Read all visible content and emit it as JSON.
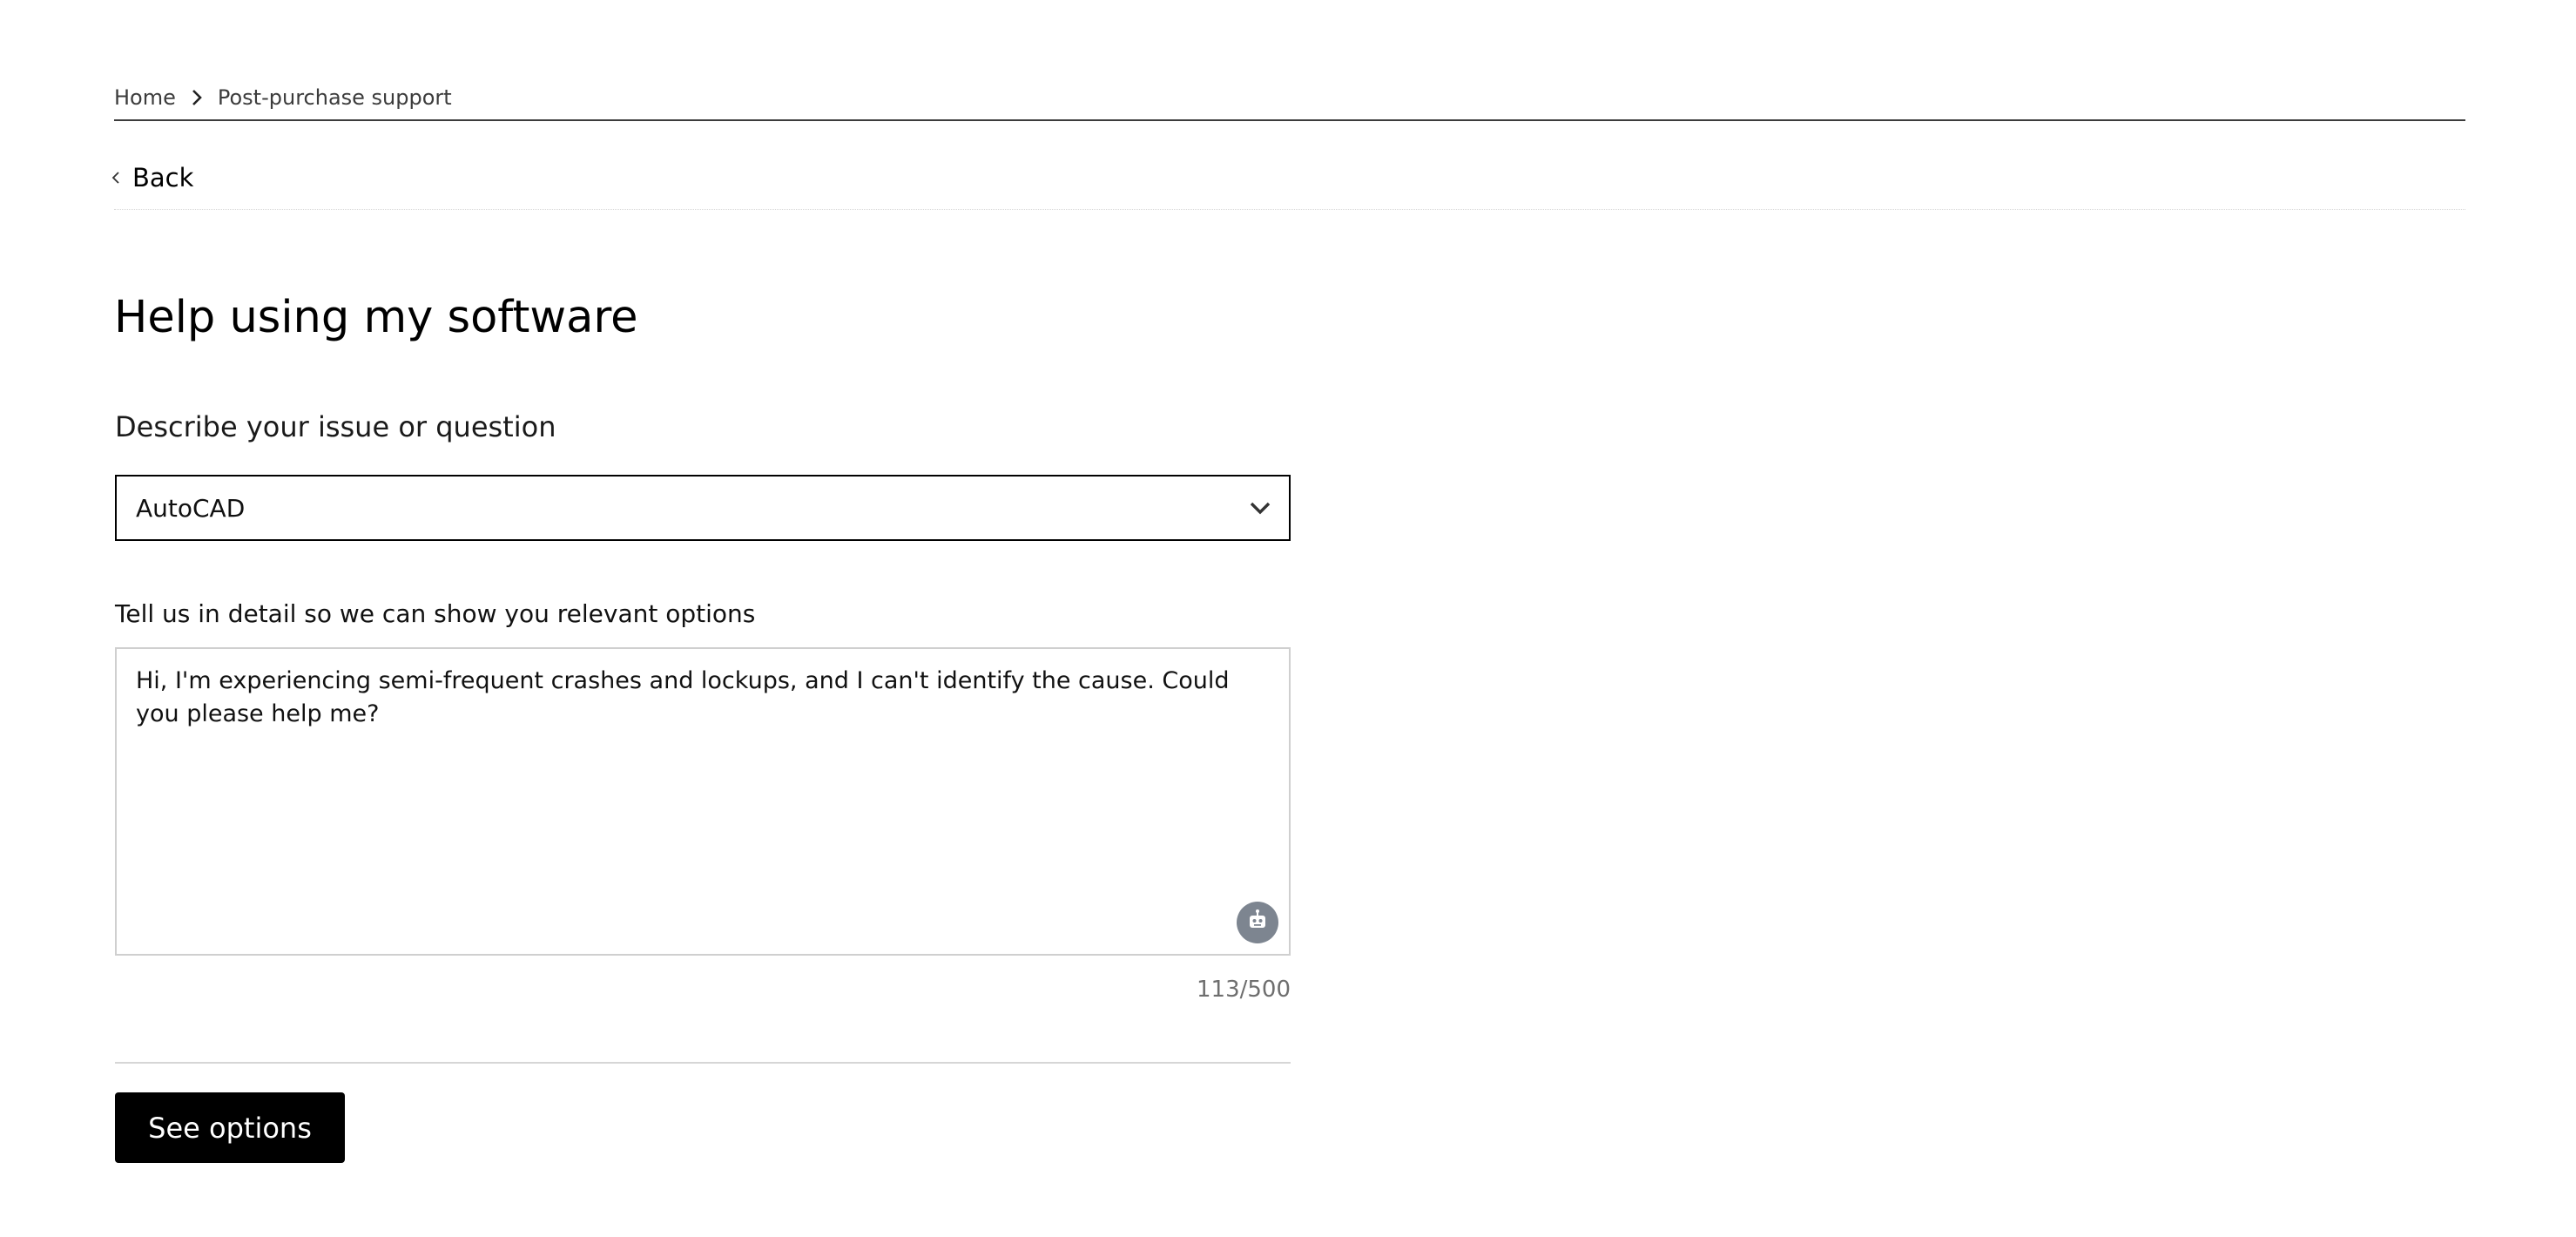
{
  "breadcrumb": {
    "items": [
      "Home",
      "Post-purchase support"
    ]
  },
  "nav": {
    "back_label": "Back"
  },
  "page": {
    "title": "Help using my software"
  },
  "form": {
    "issue_label": "Describe your issue or question",
    "product_select": {
      "selected": "AutoCAD"
    },
    "detail_label": "Tell us in detail so we can show you relevant options",
    "detail_value": "Hi, I'm experiencing semi-frequent crashes and lockups, and I can't identify the cause. Could you please help me?",
    "char_count": "113/500",
    "submit_label": "See options"
  },
  "icons": {
    "breadcrumb_separator": "chevron-right-icon",
    "back": "chevron-left-icon",
    "select": "chevron-down-icon",
    "assistant": "robot-icon"
  },
  "colors": {
    "primary_button": "#000000",
    "assistant_button": "#7d8590",
    "muted_text": "#6e6e6e"
  }
}
